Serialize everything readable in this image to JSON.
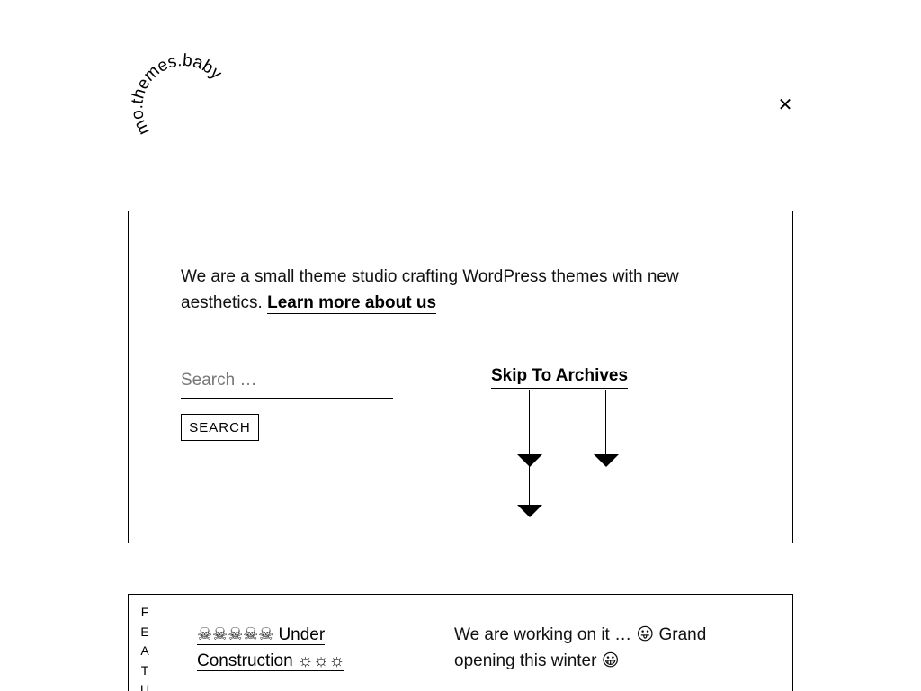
{
  "header": {
    "logo_text": "mo.themes.baby",
    "close_symbol": "✕"
  },
  "intro": {
    "text": "We are a small theme studio crafting WordPress themes with new aesthetics.",
    "link_label": "Learn more about us"
  },
  "search": {
    "placeholder": "Search …",
    "value": "",
    "button_label": "SEARCH"
  },
  "skip": {
    "label": "Skip To Archives",
    "icon": "down-arrow-icon"
  },
  "featured": {
    "vertical_label": [
      "F",
      "E",
      "A",
      "T",
      "U"
    ],
    "post_title": "☠☠☠☠☠ Under Construction ☼☼☼",
    "post_excerpt": "We are working on it … 😛 Grand opening this winter 😀"
  }
}
